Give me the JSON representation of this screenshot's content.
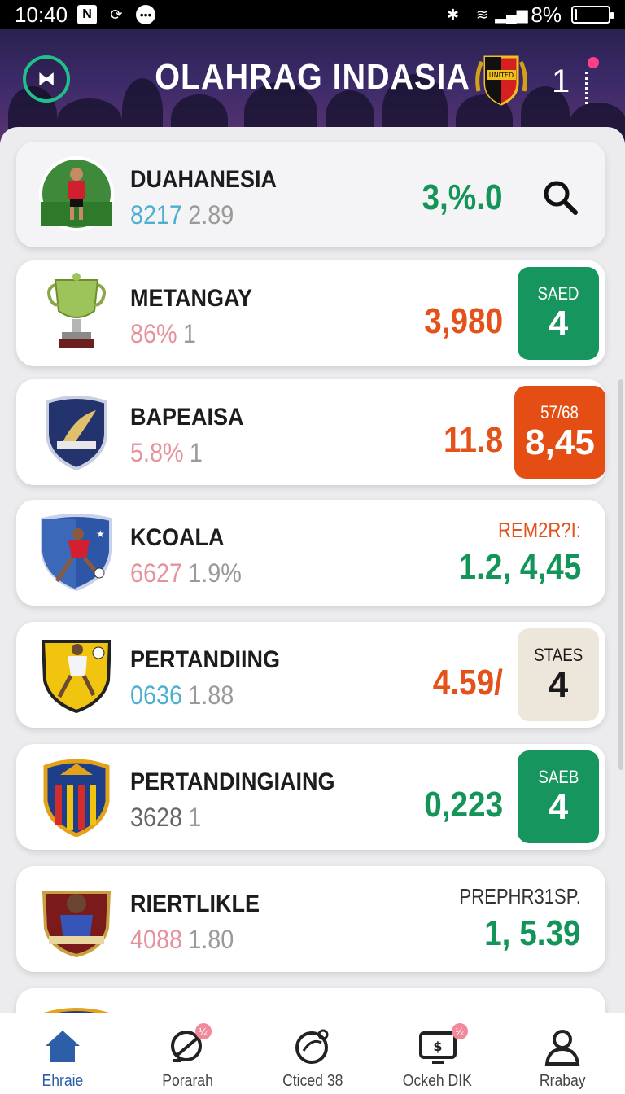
{
  "status_bar": {
    "time": "10:40",
    "battery": "8%",
    "battery_level": 0.08
  },
  "header": {
    "title": "OLAHRAG INDASIA",
    "count": "1",
    "badge_text": "UNITED"
  },
  "rows": [
    {
      "name": "DUAHANESIA",
      "sub_a": "8217",
      "sub_b": "2.89",
      "value": "3,%.0"
    },
    {
      "name": "METANGAY",
      "sub_a": "86%",
      "sub_b": "1",
      "value": "3,980",
      "box_label": "SAED",
      "box_value": "4"
    },
    {
      "name": "BAPEAISA",
      "sub_a": "5.8%",
      "sub_b": "1",
      "value": "11.8",
      "box_label": "57/68",
      "box_value": "8,45"
    },
    {
      "name": "KCOALA",
      "sub_a": "6627",
      "sub_b": "1.9%",
      "label": "REM2R?I:",
      "value": "1.2, 4,45"
    },
    {
      "name": "PERTANDIING",
      "sub_a": "0636",
      "sub_b": "1.88",
      "value": "4.59/",
      "box_label": "STAES",
      "box_value": "4"
    },
    {
      "name": "PERTANDINGIAING",
      "sub_a": "3628",
      "sub_b": "1",
      "value": "0,223",
      "box_label": "SAEB",
      "box_value": "4"
    },
    {
      "name": "RIERTLIKLE",
      "sub_a": "4088",
      "sub_b": "1.80",
      "label": "PREPHR31SP.",
      "value": "1, 5.39"
    }
  ],
  "nav": [
    {
      "label": "Ehraie",
      "icon": "home-icon"
    },
    {
      "label": "Porarah",
      "icon": "ball-icon",
      "badge": "½"
    },
    {
      "label": "Cticed 38",
      "icon": "ball-outline-icon"
    },
    {
      "label": "Ockeh DIK",
      "icon": "tv-icon",
      "badge": "½"
    },
    {
      "label": "Rrabay",
      "icon": "user-icon"
    }
  ],
  "colors": {
    "green": "#13955a",
    "orange": "#e2521a",
    "nav_active": "#2d5fa8",
    "header": "#3b2a68"
  }
}
